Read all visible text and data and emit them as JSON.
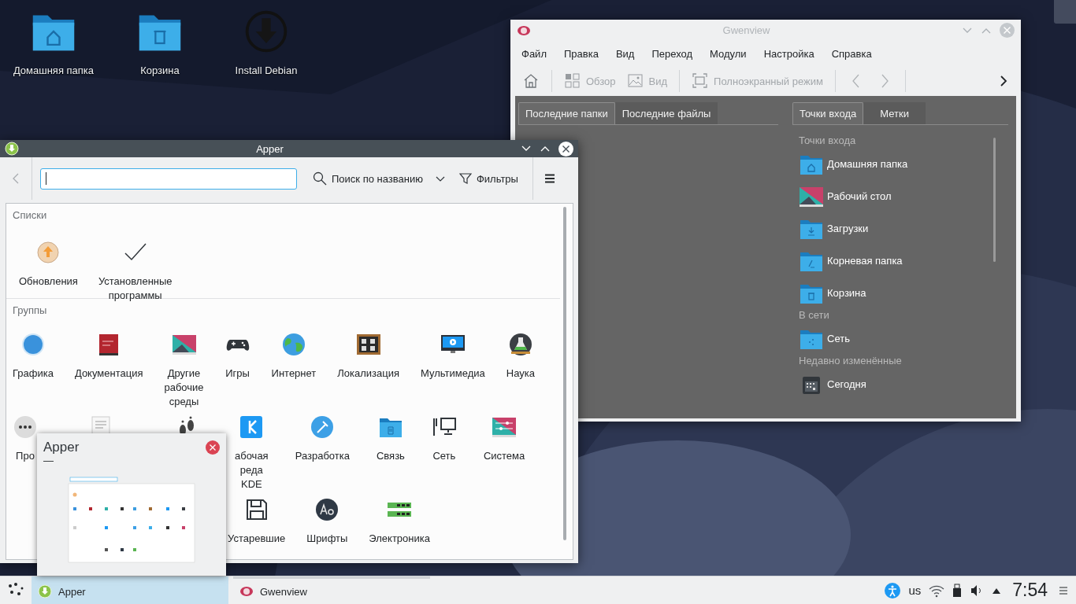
{
  "desktop": {
    "icons": [
      {
        "label": "Домашняя папка",
        "kind": "home-folder"
      },
      {
        "label": "Корзина",
        "kind": "trash-folder"
      },
      {
        "label": "Install Debian",
        "kind": "installer"
      }
    ]
  },
  "gwenview": {
    "title": "Gwenview",
    "active": false,
    "menu": [
      "Файл",
      "Правка",
      "Вид",
      "Переход",
      "Модули",
      "Настройка",
      "Справка"
    ],
    "toolbar": [
      {
        "kind": "home",
        "disabled": false
      },
      {
        "kind": "sep"
      },
      {
        "kind": "overview",
        "label": "Обзор",
        "disabled": true
      },
      {
        "kind": "view",
        "label": "Вид",
        "disabled": true
      },
      {
        "kind": "sep"
      },
      {
        "kind": "fullscreen",
        "label": "Полноэкранный режим",
        "disabled": true
      },
      {
        "kind": "sep"
      },
      {
        "kind": "back",
        "disabled": true
      },
      {
        "kind": "forward",
        "disabled": true
      },
      {
        "kind": "sep"
      },
      {
        "kind": "more",
        "disabled": false
      }
    ],
    "left_tabs": [
      {
        "label": "Последние папки",
        "selected": true
      },
      {
        "label": "Последние файлы",
        "selected": false
      }
    ],
    "right_tabs": [
      {
        "label": "Точки входа",
        "selected": true
      },
      {
        "label": "Метки",
        "selected": false
      }
    ],
    "places": [
      {
        "heading": "Точки входа",
        "items": [
          {
            "label": "Домашняя папка",
            "kind": "home-folder"
          },
          {
            "label": "Рабочий стол",
            "kind": "desktop"
          },
          {
            "label": "Загрузки",
            "kind": "download-folder"
          },
          {
            "label": "Корневая папка",
            "kind": "root-folder"
          },
          {
            "label": "Корзина",
            "kind": "trash-folder"
          }
        ]
      },
      {
        "heading": "В сети",
        "items": [
          {
            "label": "Сеть",
            "kind": "network-folder"
          }
        ]
      },
      {
        "heading": "Недавно изменённые",
        "items": [
          {
            "label": "Сегодня",
            "kind": "calendar"
          }
        ]
      }
    ]
  },
  "apper": {
    "title": "Apper",
    "active": true,
    "back_disabled": true,
    "search_mode": "Поиск по названию",
    "filters": "Фильтры",
    "sections": [
      {
        "heading": "Списки",
        "rows": [
          [
            {
              "label": "Обновления",
              "kind": "update"
            },
            {
              "label": "Установленные программы",
              "kind": "check"
            }
          ]
        ]
      },
      {
        "heading": "Группы",
        "rows": [
          [
            {
              "label": "Графика",
              "kind": "ball"
            },
            {
              "label": "Документация",
              "kind": "book"
            },
            {
              "label": "Другие рабочие среды",
              "kind": "desktop"
            },
            {
              "label": "Игры",
              "kind": "gamepad"
            },
            {
              "label": "Интернет",
              "kind": "globe"
            },
            {
              "label": "Локализация",
              "kind": "board"
            },
            {
              "label": "Мультимедиа",
              "kind": "monitor"
            },
            {
              "label": "Наука",
              "kind": "flask"
            }
          ],
          [
            {
              "label": "Про",
              "kind": "dots"
            },
            {
              "kind": "document"
            },
            {
              "kind": "feet"
            },
            {
              "label": "абочая реда KDE",
              "kind": "kde"
            },
            {
              "label": "Разработка",
              "kind": "hammer"
            },
            {
              "label": "Связь",
              "kind": "folder"
            },
            {
              "label": "Сеть",
              "kind": "netpc"
            },
            {
              "label": "Система",
              "kind": "system"
            }
          ],
          [
            "",
            "",
            "",
            {
              "label": "Устаревшие",
              "kind": "floppy"
            },
            {
              "label": "Шрифты",
              "kind": "font"
            },
            {
              "label": "Электроника",
              "kind": "memory"
            }
          ]
        ]
      }
    ]
  },
  "preview": {
    "title": "Apper",
    "subtitle": "—"
  },
  "taskbar": {
    "tasks": [
      {
        "label": "Apper",
        "kind": "apper",
        "selected": true
      },
      {
        "label": "Gwenview",
        "kind": "gwenview",
        "selected": false
      }
    ],
    "layout": "us",
    "clock": "7:54"
  }
}
